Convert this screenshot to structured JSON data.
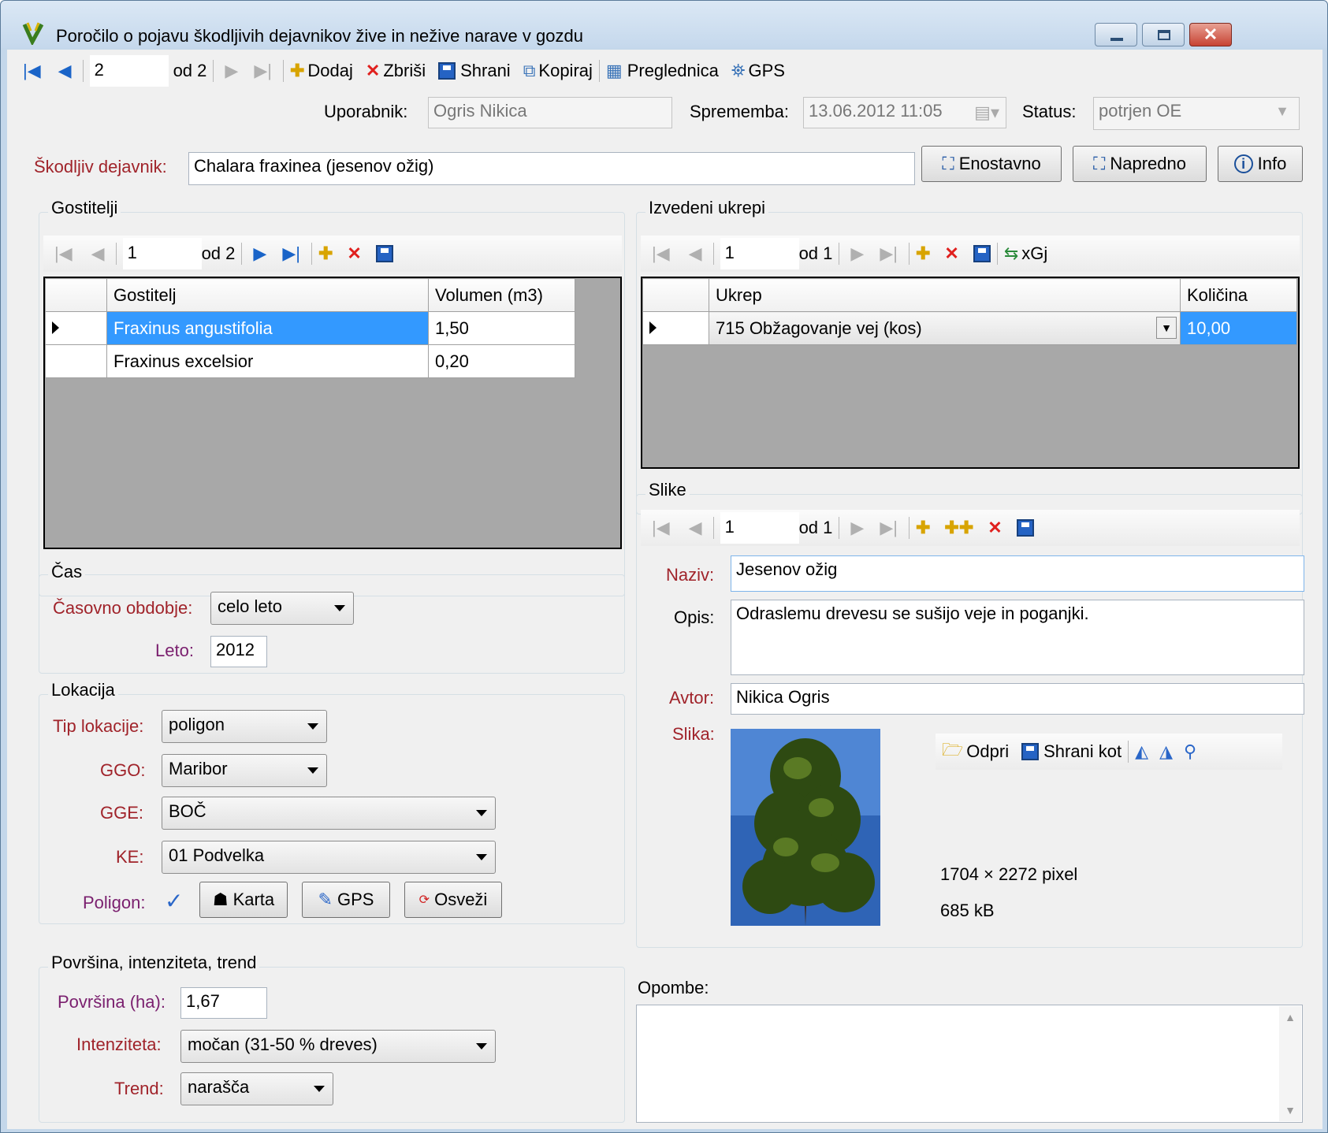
{
  "window": {
    "title": "Poročilo o pojavu škodljivih dejavnikov žive in nežive narave v gozdu"
  },
  "main_nav": {
    "current": "2",
    "of": "od 2",
    "add": "Dodaj",
    "delete": "Zbriši",
    "save": "Shrani",
    "copy": "Kopiraj",
    "grid": "Preglednica",
    "gps": "GPS"
  },
  "header": {
    "user_label": "Uporabnik:",
    "user_value": "Ogris Nikica",
    "change_label": "Sprememba:",
    "change_value": "13.06.2012 11:05",
    "status_label": "Status:",
    "status_value": "potrjen OE"
  },
  "factor": {
    "label": "Škodljiv dejavnik:",
    "value": "Chalara fraxinea (jesenov ožig)",
    "simple_button": "Enostavno",
    "advanced_button": "Napredno",
    "info_button": "Info"
  },
  "hosts": {
    "title": "Gostitelji",
    "nav_current": "1",
    "nav_of": "od 2",
    "columns": [
      "Gostitelj",
      "Volumen (m3)"
    ],
    "rows": [
      {
        "host": "Fraxinus angustifolia",
        "volume": "1,50"
      },
      {
        "host": "Fraxinus excelsior",
        "volume": "0,20"
      }
    ]
  },
  "measures": {
    "title": "Izvedeni ukrepi",
    "nav_current": "1",
    "nav_of": "od 1",
    "xgj": "xGj",
    "columns": [
      "Ukrep",
      "Količina"
    ],
    "rows": [
      {
        "measure": "715 Obžagovanje vej (kos)",
        "quantity": "10,00"
      }
    ]
  },
  "time": {
    "title": "Čas",
    "period_label": "Časovno obdobje:",
    "period_value": "celo leto",
    "year_label": "Leto:",
    "year_value": "2012"
  },
  "location": {
    "title": "Lokacija",
    "type_label": "Tip lokacije:",
    "type_value": "poligon",
    "ggo_label": "GGO:",
    "ggo_value": "Maribor",
    "gge_label": "GGE:",
    "gge_value": "BOČ",
    "ke_label": "KE:",
    "ke_value": "01 Podvelka",
    "polygon_label": "Poligon:",
    "map_button": "Karta",
    "gps_button": "GPS",
    "refresh_button": "Osveži"
  },
  "area": {
    "title": "Površina, intenziteta, trend",
    "area_label": "Površina (ha):",
    "area_value": "1,67",
    "intensity_label": "Intenziteta:",
    "intensity_value": "močan (31-50 % dreves)",
    "trend_label": "Trend:",
    "trend_value": "narašča"
  },
  "images": {
    "title": "Slike",
    "nav_current": "1",
    "nav_of": "od 1",
    "name_label": "Naziv:",
    "name_value": "Jesenov ožig",
    "desc_label": "Opis:",
    "desc_value": "Odraslemu drevesu se sušijo veje in poganjki.",
    "author_label": "Avtor:",
    "author_value": "Nikica Ogris",
    "image_label": "Slika:",
    "open_button": "Odpri",
    "save_as_button": "Shrani kot",
    "dimensions": "1704 × 2272 pixel",
    "size": "685 kB"
  },
  "notes": {
    "label": "Opombe:",
    "value": ""
  }
}
